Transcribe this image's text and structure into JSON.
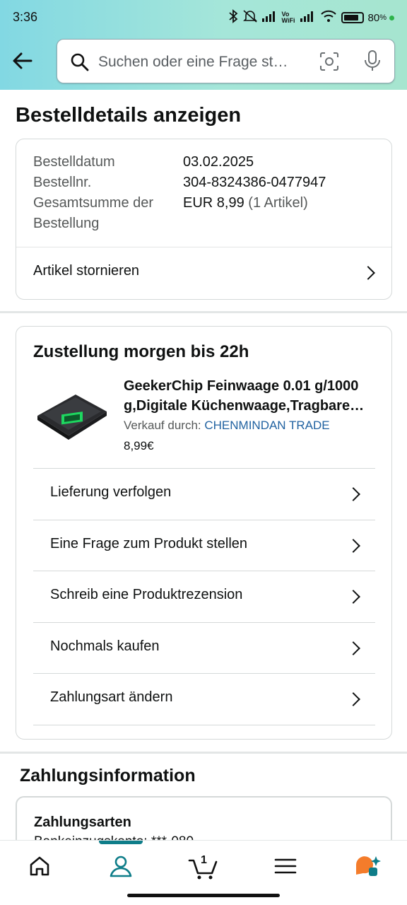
{
  "status_bar": {
    "time": "3:36",
    "battery": "80",
    "network": "Vo WiFi"
  },
  "search": {
    "placeholder": "Suchen oder eine Frage st…"
  },
  "page_title": "Bestelldetails anzeigen",
  "order": {
    "date_label": "Bestelldatum",
    "date_value": "03.02.2025",
    "number_label": "Bestellnr.",
    "number_value": "304-8324386-0477947",
    "total_label": "Gesamtsumme der Bestellung",
    "total_value": "EUR 8,99",
    "total_items": "(1 Artikel)",
    "cancel_label": "Artikel stornieren"
  },
  "delivery": {
    "heading": "Zustellung morgen bis 22h",
    "product_title": "GeekerChip Feinwaage 0.01 g/1000 g,Digitale Küchenwaage,Tragbare…",
    "seller_prefix": "Verkauf durch:",
    "seller_name": "CHENMINDAN TRADE",
    "price": "8,99€",
    "actions": [
      "Lieferung verfolgen",
      "Eine Frage zum Produkt stellen",
      "Schreib eine Produktrezension",
      "Nochmals kaufen",
      "Zahlungsart ändern"
    ]
  },
  "payment": {
    "heading": "Zahlungsinformation",
    "methods_label": "Zahlungsarten",
    "methods_value": "Bankeinzugskonto: ***-080"
  },
  "bottom_nav": {
    "cart_count": "1"
  },
  "colors": {
    "accent": "#0e7d89",
    "link": "#2162a1",
    "header_start": "#82d8e3",
    "header_end": "#a6e5cf"
  }
}
